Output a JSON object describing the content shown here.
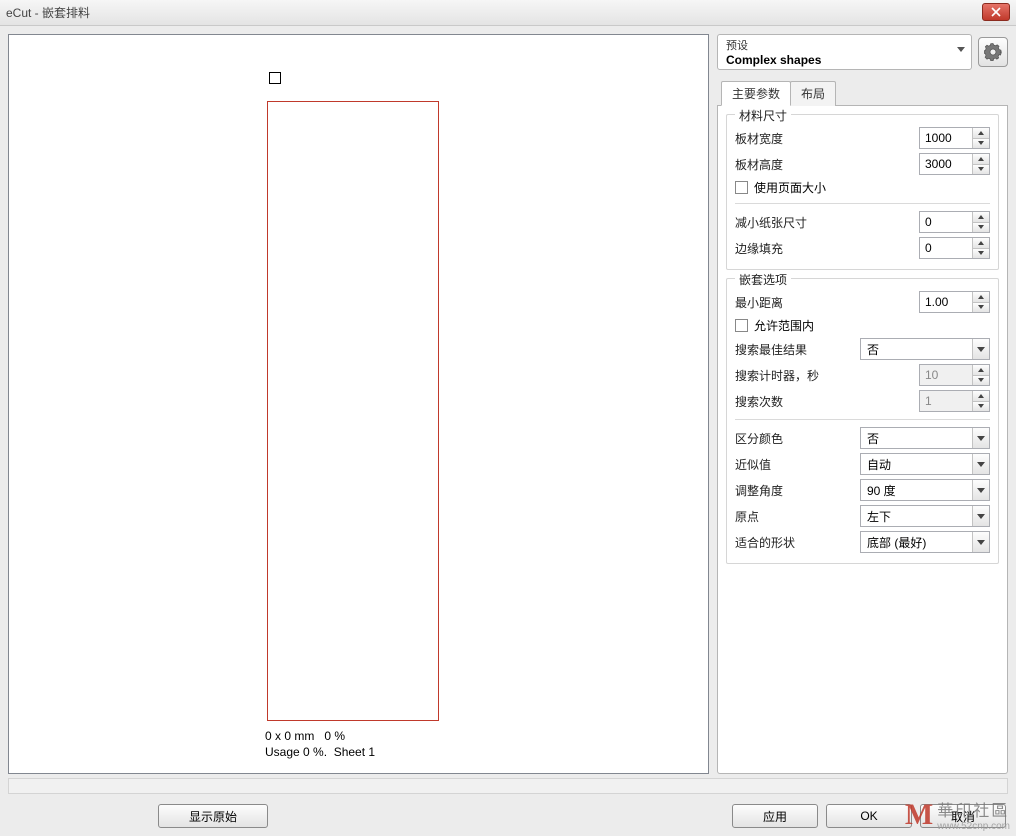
{
  "window": {
    "title": "eCut - 嵌套排料"
  },
  "preview": {
    "info_line1": "0 x 0 mm   0 %",
    "info_line2": "Usage 0 %.  Sheet 1"
  },
  "preset": {
    "label": "预设",
    "value": "Complex shapes"
  },
  "tabs": {
    "main": "主要参数",
    "layout": "布局"
  },
  "groups": {
    "material": {
      "title": "材料尺寸",
      "sheet_width_label": "板材宽度",
      "sheet_width_value": "1000",
      "sheet_height_label": "板材高度",
      "sheet_height_value": "3000",
      "use_page_size_label": "使用页面大小",
      "reduce_paper_label": "减小纸张尺寸",
      "reduce_paper_value": "0",
      "edge_fill_label": "边缘填充",
      "edge_fill_value": "0"
    },
    "nesting": {
      "title": "嵌套选项",
      "min_distance_label": "最小距离",
      "min_distance_value": "1.00",
      "allow_inside_label": "允许范围内",
      "search_best_label": "搜索最佳结果",
      "search_best_value": "否",
      "timer_label": "搜索计时器，秒",
      "timer_value": "10",
      "search_count_label": "搜索次数",
      "search_count_value": "1",
      "diff_color_label": "区分颜色",
      "diff_color_value": "否",
      "approx_label": "近似值",
      "approx_value": "自动",
      "angle_label": "调整角度",
      "angle_value": "90 度",
      "origin_label": "原点",
      "origin_value": "左下",
      "fit_shape_label": "适合的形状",
      "fit_shape_value": "底部 (最好)"
    }
  },
  "buttons": {
    "show_original": "显示原始",
    "apply": "应用",
    "ok": "OK",
    "cancel": "取消"
  },
  "watermark": {
    "cn": "華印社區",
    "url": "www.52cnp.com"
  }
}
